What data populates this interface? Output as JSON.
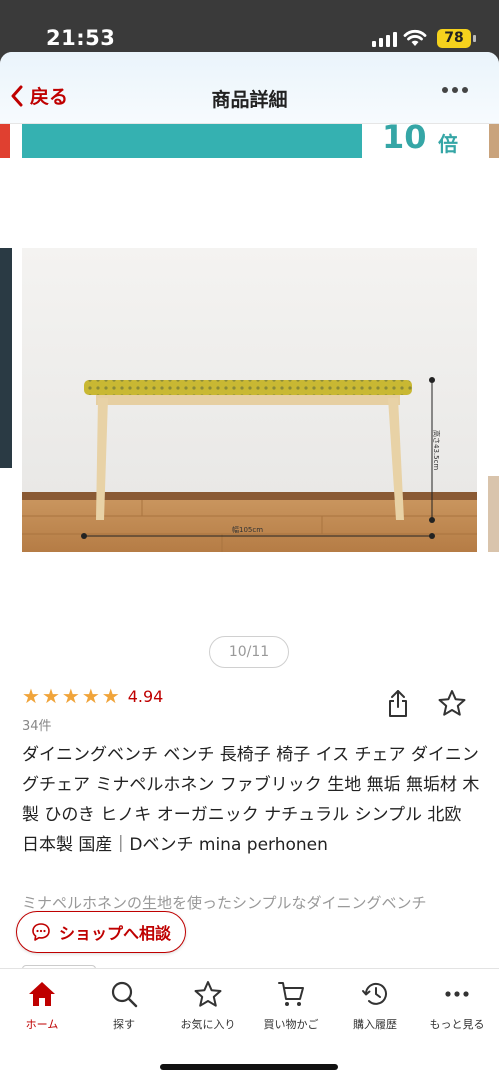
{
  "status_bar": {
    "time": "21:53",
    "battery": "78"
  },
  "nav": {
    "back_label": "戻る",
    "title": "商品詳細"
  },
  "banner": {
    "multiplier": "10",
    "unit": "倍"
  },
  "product_image": {
    "width_label": "幅105cm",
    "height_label": "高さ43.5cm"
  },
  "pager": {
    "text": "10/11"
  },
  "rating": {
    "value": "4.94",
    "stars": 5,
    "count": "34件"
  },
  "product": {
    "title": "ダイニングベンチ ベンチ 長椅子 椅子 イス チェア ダイニングチェア ミナペルホネン ファブリック 生地 無垢 無垢材 木製 ひのき ヒノキ オーガニック ナチュラル シンプル 北欧 日本製 国産｜Dベンチ mina perhonen",
    "description": "ミナペルホネンの生地を使ったシンプルなダイニングベンチ"
  },
  "consult_button": {
    "label": "ショップへ相談"
  },
  "tabbar": {
    "items": [
      {
        "label": "ホーム",
        "icon": "home-icon"
      },
      {
        "label": "探す",
        "icon": "search-icon"
      },
      {
        "label": "お気に入り",
        "icon": "star-icon"
      },
      {
        "label": "買い物かご",
        "icon": "cart-icon"
      },
      {
        "label": "購入履歴",
        "icon": "history-icon"
      },
      {
        "label": "もっと見る",
        "icon": "more-icon"
      }
    ]
  },
  "colors": {
    "accent": "#bf0000",
    "star": "#f0a43a",
    "banner": "#35b1b1",
    "fabric": "#c9b833"
  }
}
